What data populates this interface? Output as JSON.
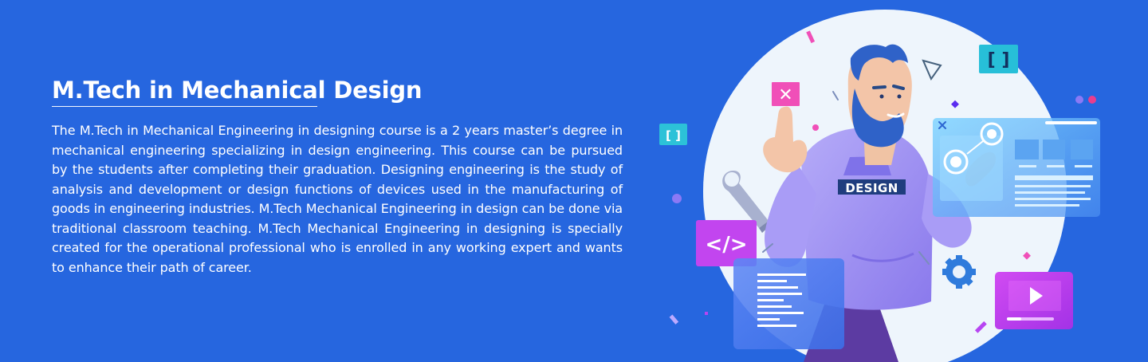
{
  "hero": {
    "title": "M.Tech in Mechanical Design",
    "description": "The M.Tech in Mechanical Engineering in designing course is a 2 years master’s degree in mechanical engineering specializing in design engineering. This course can be pursued by the students after completing their graduation. Designing engineering is the study of analysis and development or design functions of devices used in the manufacturing of goods in engineering industries. M.Tech Mechanical Engineering in design can be done via traditional classroom teaching. M.Tech Mechanical Engineering in designing is specially created for the operational professional who is enrolled in any working expert and wants to enhance their path of career."
  },
  "illustration": {
    "shirt_label": "DESIGN",
    "code_tag": "</>",
    "bracket_small": "[ ]",
    "bracket_large": "[ ]",
    "close_symbol": "✕"
  },
  "colors": {
    "background": "#2666df",
    "circle": "#eaf2fb",
    "accent_pink": "#ef4fb6",
    "accent_cyan": "#26c7df",
    "hoodie": "#9f93f6",
    "panel": "#5fb3f6"
  },
  "icons": [
    "wrench-icon",
    "gear-icon",
    "play-icon",
    "code-icon",
    "close-icon",
    "bracket-icon"
  ]
}
